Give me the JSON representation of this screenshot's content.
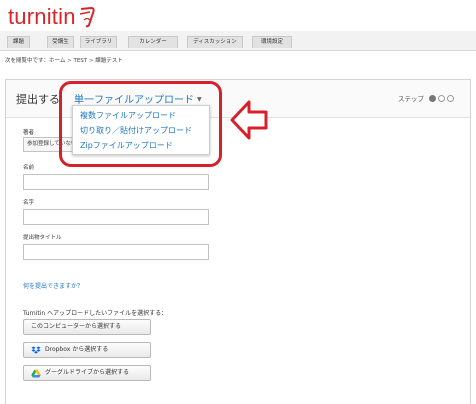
{
  "brand": {
    "logo_text": "turnitin",
    "color": "#d9252a"
  },
  "nav": {
    "tabs": [
      "課題",
      "受講生",
      "ライブラリ",
      "カレンダー",
      "ディスカッション",
      "環境設定"
    ]
  },
  "breadcrumb": {
    "prefix": "次を閲覧中です：",
    "items": [
      "ホーム",
      "TEST",
      "課題テスト"
    ],
    "separator": ">"
  },
  "panel": {
    "title": "提出する",
    "upload_type": "単一ファイルアップロード",
    "steps_label": "ステップ",
    "steps_total": 3,
    "steps_current": 1
  },
  "dropdown": {
    "items": [
      "複数ファイルアップロード",
      "切り取り／貼付けアップロード",
      "Zipファイルアップロード"
    ]
  },
  "form": {
    "author_label": "著者",
    "author_value": "参加登録していない学生",
    "first_name_label": "名前",
    "last_name_label": "名字",
    "title_label": "提出物タイトル",
    "what_can_submit": "何を提出できますか？",
    "choose_file_label": "Turnitin へアップロードしたいファイルを選択する：",
    "btn_computer": "このコンピューターから選択する",
    "btn_dropbox": "Dropbox から選択する",
    "btn_gdrive": "グーグルドライブから選択する"
  },
  "annotation": {
    "highlight_color": "#d4212b"
  }
}
